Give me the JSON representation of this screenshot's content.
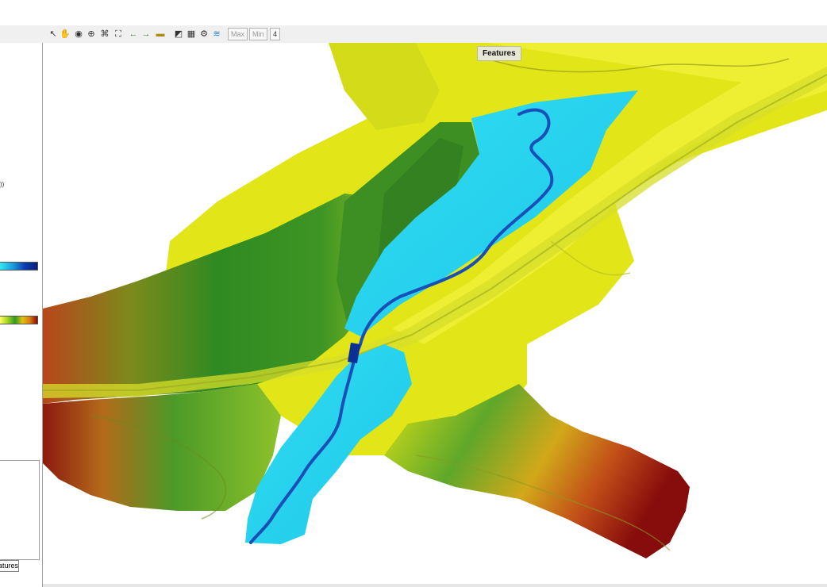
{
  "toolbar": {
    "icons": [
      "select-arrow-icon",
      "pan-hand-icon",
      "globe-icon",
      "zoom-icon",
      "fit-extent-icon",
      "zoom-extent-icon",
      "back-arrow-icon",
      "forward-arrow-icon",
      "measure-icon",
      "layer-icon",
      "grid-icon",
      "gear-icon",
      "water-layer-icon"
    ],
    "max_label": "Max",
    "min_label": "Min",
    "more_label": "4"
  },
  "left_panel": {
    "legend_fragment": "))",
    "water_scale_colors": [
      "#35e6f0",
      "#1b9ee0",
      "#0c3db0",
      "#0b1f80"
    ],
    "elevation_scale_colors": [
      "#ffff66",
      "#a8d320",
      "#2e9a25",
      "#e0c010",
      "#d87a10",
      "#8a0808"
    ],
    "tab_label": "Features"
  },
  "map": {
    "tooltip": "Features",
    "colors": {
      "water_light": "#2bd6ee",
      "water_channel": "#1a4fb8",
      "low_ground": "#e7e814",
      "mid_ground": "#5aa72a",
      "high_ground": "#a6451a",
      "peak_ground": "#8c0c0c"
    }
  }
}
